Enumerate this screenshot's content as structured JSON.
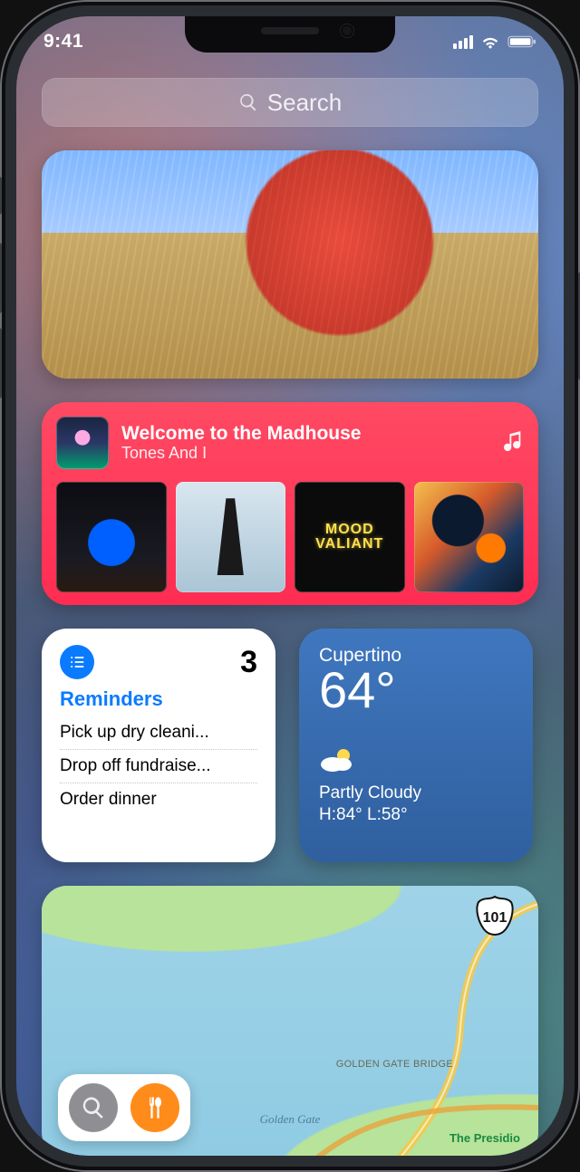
{
  "status": {
    "time": "9:41"
  },
  "search": {
    "placeholder": "Search"
  },
  "music": {
    "title": "Welcome to the Madhouse",
    "artist": "Tones And I",
    "tile3_line1": "MOOD",
    "tile3_line2": "VALIANT"
  },
  "reminders": {
    "count": "3",
    "title": "Reminders",
    "items": [
      "Pick up dry cleani...",
      "Drop off fundraise...",
      "Order dinner"
    ]
  },
  "weather": {
    "city": "Cupertino",
    "temp": "64°",
    "condition": "Partly Cloudy",
    "hilo": "H:84° L:58°"
  },
  "maps": {
    "route_shield": "101",
    "label_water": "Golden Gate",
    "label_bridge": "GOLDEN GATE BRIDGE",
    "label_presidio": "The Presidio"
  }
}
